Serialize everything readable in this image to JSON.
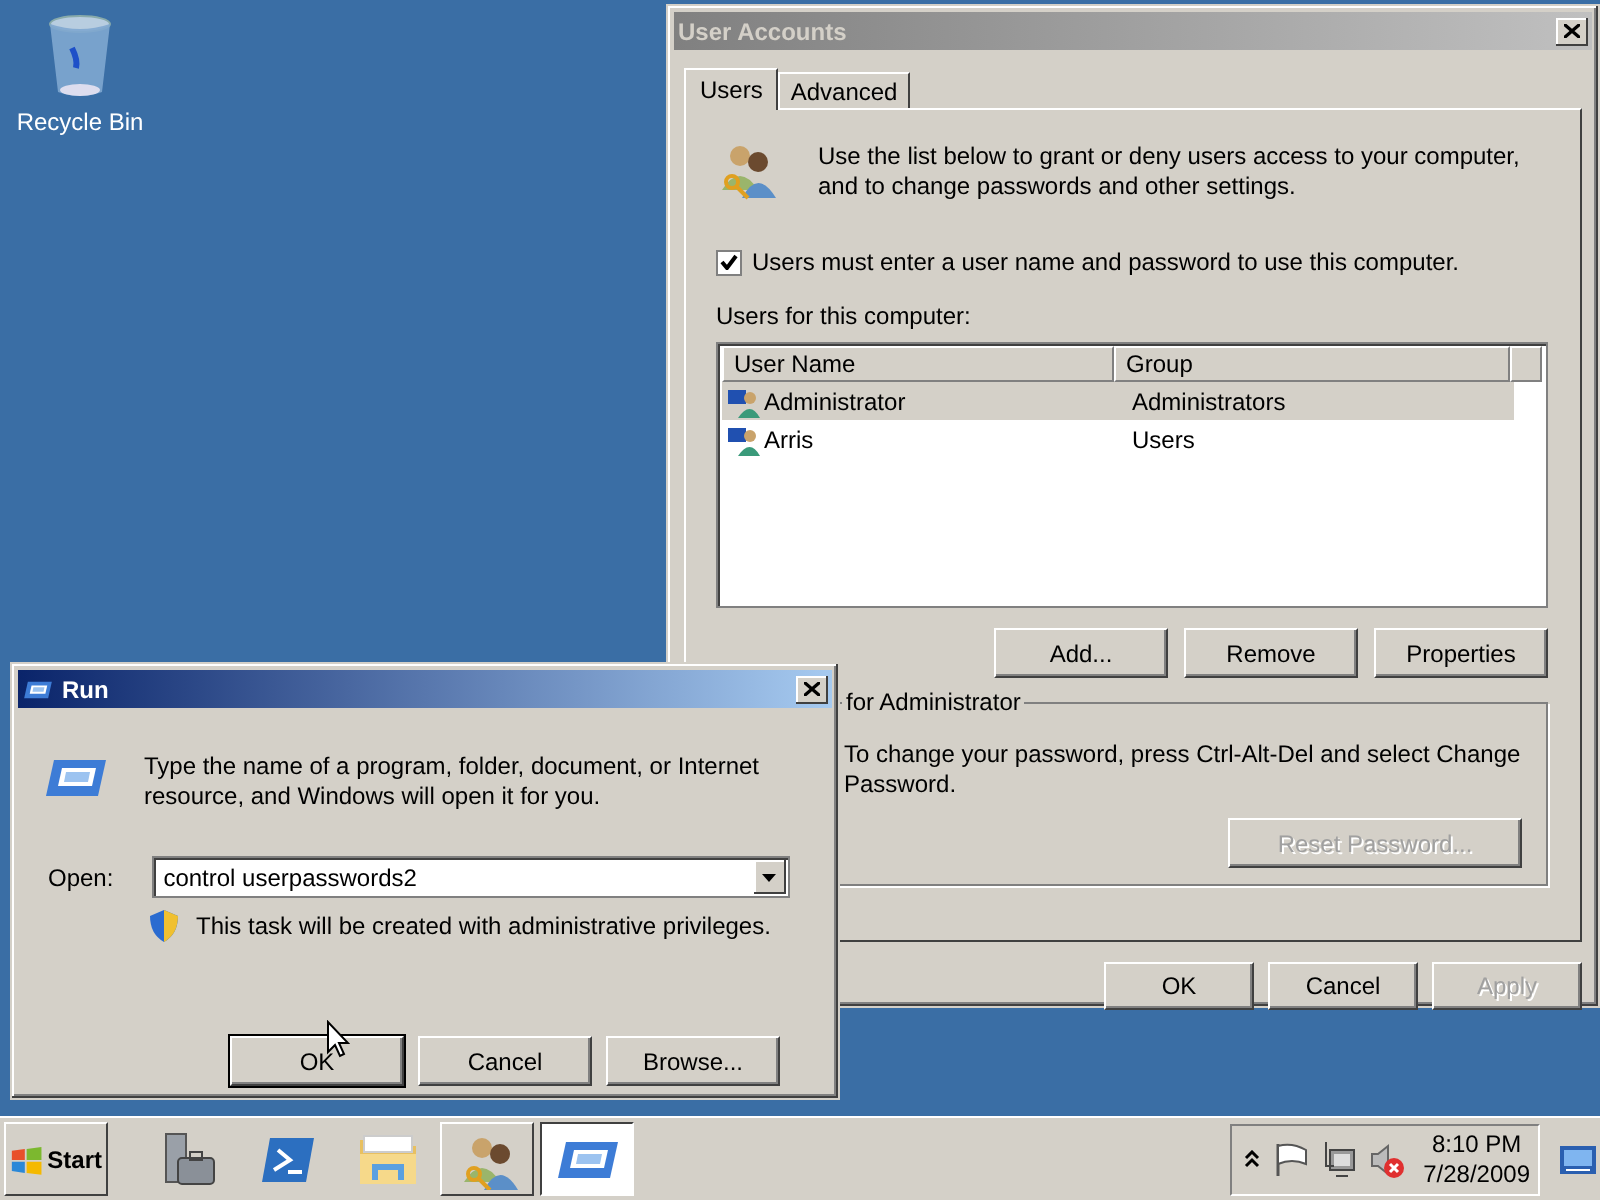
{
  "desktop_icons": [
    {
      "label": "Recycle Bin"
    }
  ],
  "user_accounts": {
    "title": "User Accounts",
    "active": false,
    "tabs": [
      {
        "label": "Users",
        "selected": true
      },
      {
        "label": "Advanced",
        "selected": false
      }
    ],
    "intro": "Use the list below to grant or deny users access to your computer, and to change passwords and other settings.",
    "require_password": {
      "label": "Users must enter a user name and password to use this computer.",
      "checked": true
    },
    "list_label": "Users for this computer:",
    "columns": [
      "User Name",
      "Group"
    ],
    "rows": [
      {
        "name": "Administrator",
        "group": "Administrators",
        "selected": true
      },
      {
        "name": "Arris",
        "group": "Users",
        "selected": false
      }
    ],
    "list_buttons": [
      {
        "label": "Add...",
        "disabled": false
      },
      {
        "label": "Remove",
        "disabled": false
      },
      {
        "label": "Properties",
        "disabled": false
      }
    ],
    "password_group": {
      "title": "for Administrator",
      "text": "To change your password, press Ctrl-Alt-Del and select Change Password.",
      "button": {
        "label": "Reset Password...",
        "disabled": true
      }
    },
    "buttons": [
      {
        "label": "OK",
        "disabled": false
      },
      {
        "label": "Cancel",
        "disabled": false
      },
      {
        "label": "Apply",
        "disabled": true
      }
    ]
  },
  "run_dialog": {
    "title": "Run",
    "active": true,
    "prompt": "Type the name of a program, folder, document, or Internet resource, and Windows will open it for you.",
    "open_label": "Open:",
    "open_value": "control userpasswords2",
    "admin_note": "This task will be created with administrative privileges.",
    "buttons": [
      {
        "label": "OK",
        "default": true
      },
      {
        "label": "Cancel",
        "default": false
      },
      {
        "label": "Browse...",
        "default": false
      }
    ]
  },
  "taskbar": {
    "start": "Start",
    "items": [
      {
        "kind": "server",
        "open": false,
        "selected": false
      },
      {
        "kind": "shell",
        "open": false,
        "selected": false
      },
      {
        "kind": "folder",
        "open": false,
        "selected": false
      },
      {
        "kind": "users",
        "open": true,
        "selected": false
      },
      {
        "kind": "run",
        "open": true,
        "selected": true
      }
    ],
    "clock": {
      "time": "8:10 PM",
      "date": "7/28/2009"
    }
  }
}
